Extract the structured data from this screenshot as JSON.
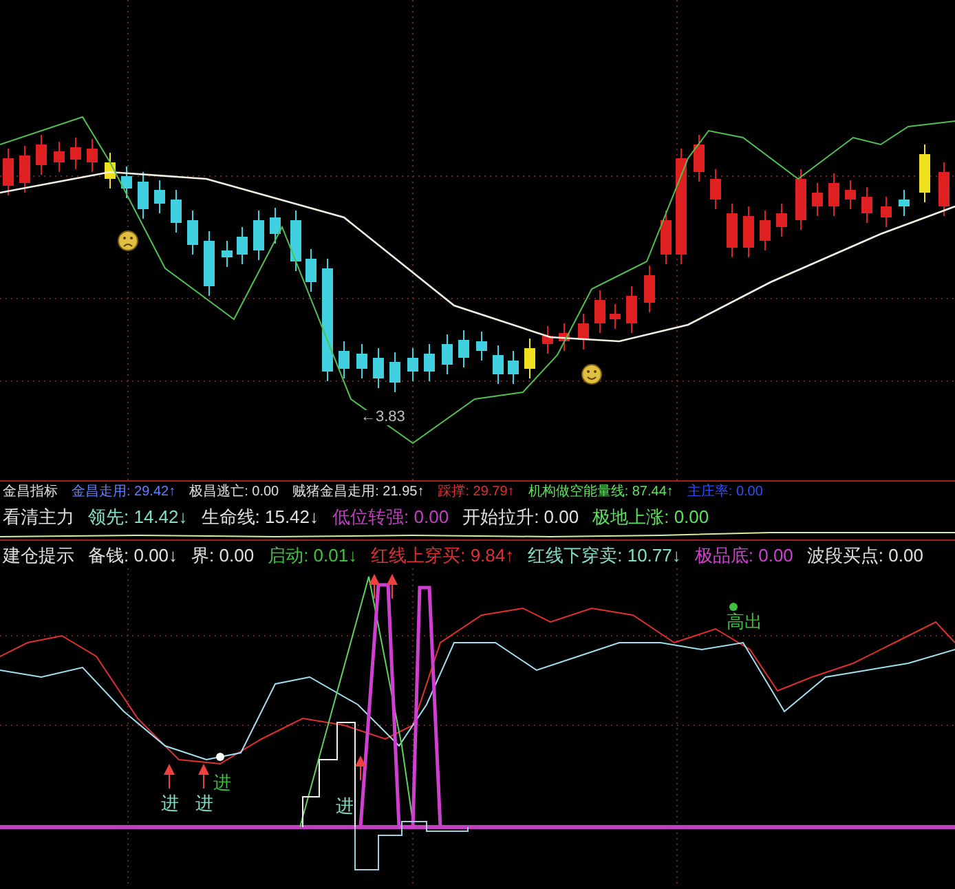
{
  "main_chart": {
    "low_label": "←3.83"
  },
  "indicator_rows": [
    {
      "items": [
        {
          "text": "金昌指标",
          "color": "#e0e0e0"
        },
        {
          "text": "金昌走用: 29.42↑",
          "color": "#6080ff"
        },
        {
          "text": "极昌逃亡: 0.00",
          "color": "#e0e0e0"
        },
        {
          "text": "贼猪金昌走用: 21.95↑",
          "color": "#e0e0e0"
        },
        {
          "text": "踩撑: 29.79↑",
          "color": "#e03030"
        },
        {
          "text": "机构做空能量线: 87.44↑",
          "color": "#60e060"
        },
        {
          "text": "主庄率: 0.00",
          "color": "#3050ff"
        }
      ]
    },
    {
      "items": [
        {
          "text": "看清主力",
          "color": "#e0e0e0"
        },
        {
          "text": "领先: 14.42↓",
          "color": "#80e0c8"
        },
        {
          "text": "生命线: 15.42↓",
          "color": "#e0e0e0"
        },
        {
          "text": "低位转强: 0.00",
          "color": "#c040c0"
        },
        {
          "text": "开始拉升: 0.00",
          "color": "#e0e0e0"
        },
        {
          "text": "极地上涨: 0.00",
          "color": "#60e060"
        }
      ]
    },
    {
      "items": [
        {
          "text": "建仓提示",
          "color": "#e0e0e0"
        },
        {
          "text": "备钱: 0.00↓",
          "color": "#e0e0e0"
        },
        {
          "text": "界: 0.00",
          "color": "#e0e0e0"
        },
        {
          "text": "启动: 0.01↓",
          "color": "#40c040"
        },
        {
          "text": "红线上穿买: 9.84↑",
          "color": "#e03030"
        },
        {
          "text": "红线下穿卖: 10.77↓",
          "color": "#80e0c8"
        },
        {
          "text": "极品底: 0.00",
          "color": "#d040d0"
        },
        {
          "text": "波段买点: 0.00",
          "color": "#e0e0e0"
        }
      ]
    }
  ],
  "signals": [
    {
      "text": "进",
      "color": "#80e0c8"
    },
    {
      "text": "进",
      "color": "#80e0c8"
    },
    {
      "text": "进",
      "color": "#40c040"
    },
    {
      "text": "进",
      "color": "#80e0c8"
    },
    {
      "text": "高出",
      "color": "#40c040"
    }
  ]
}
